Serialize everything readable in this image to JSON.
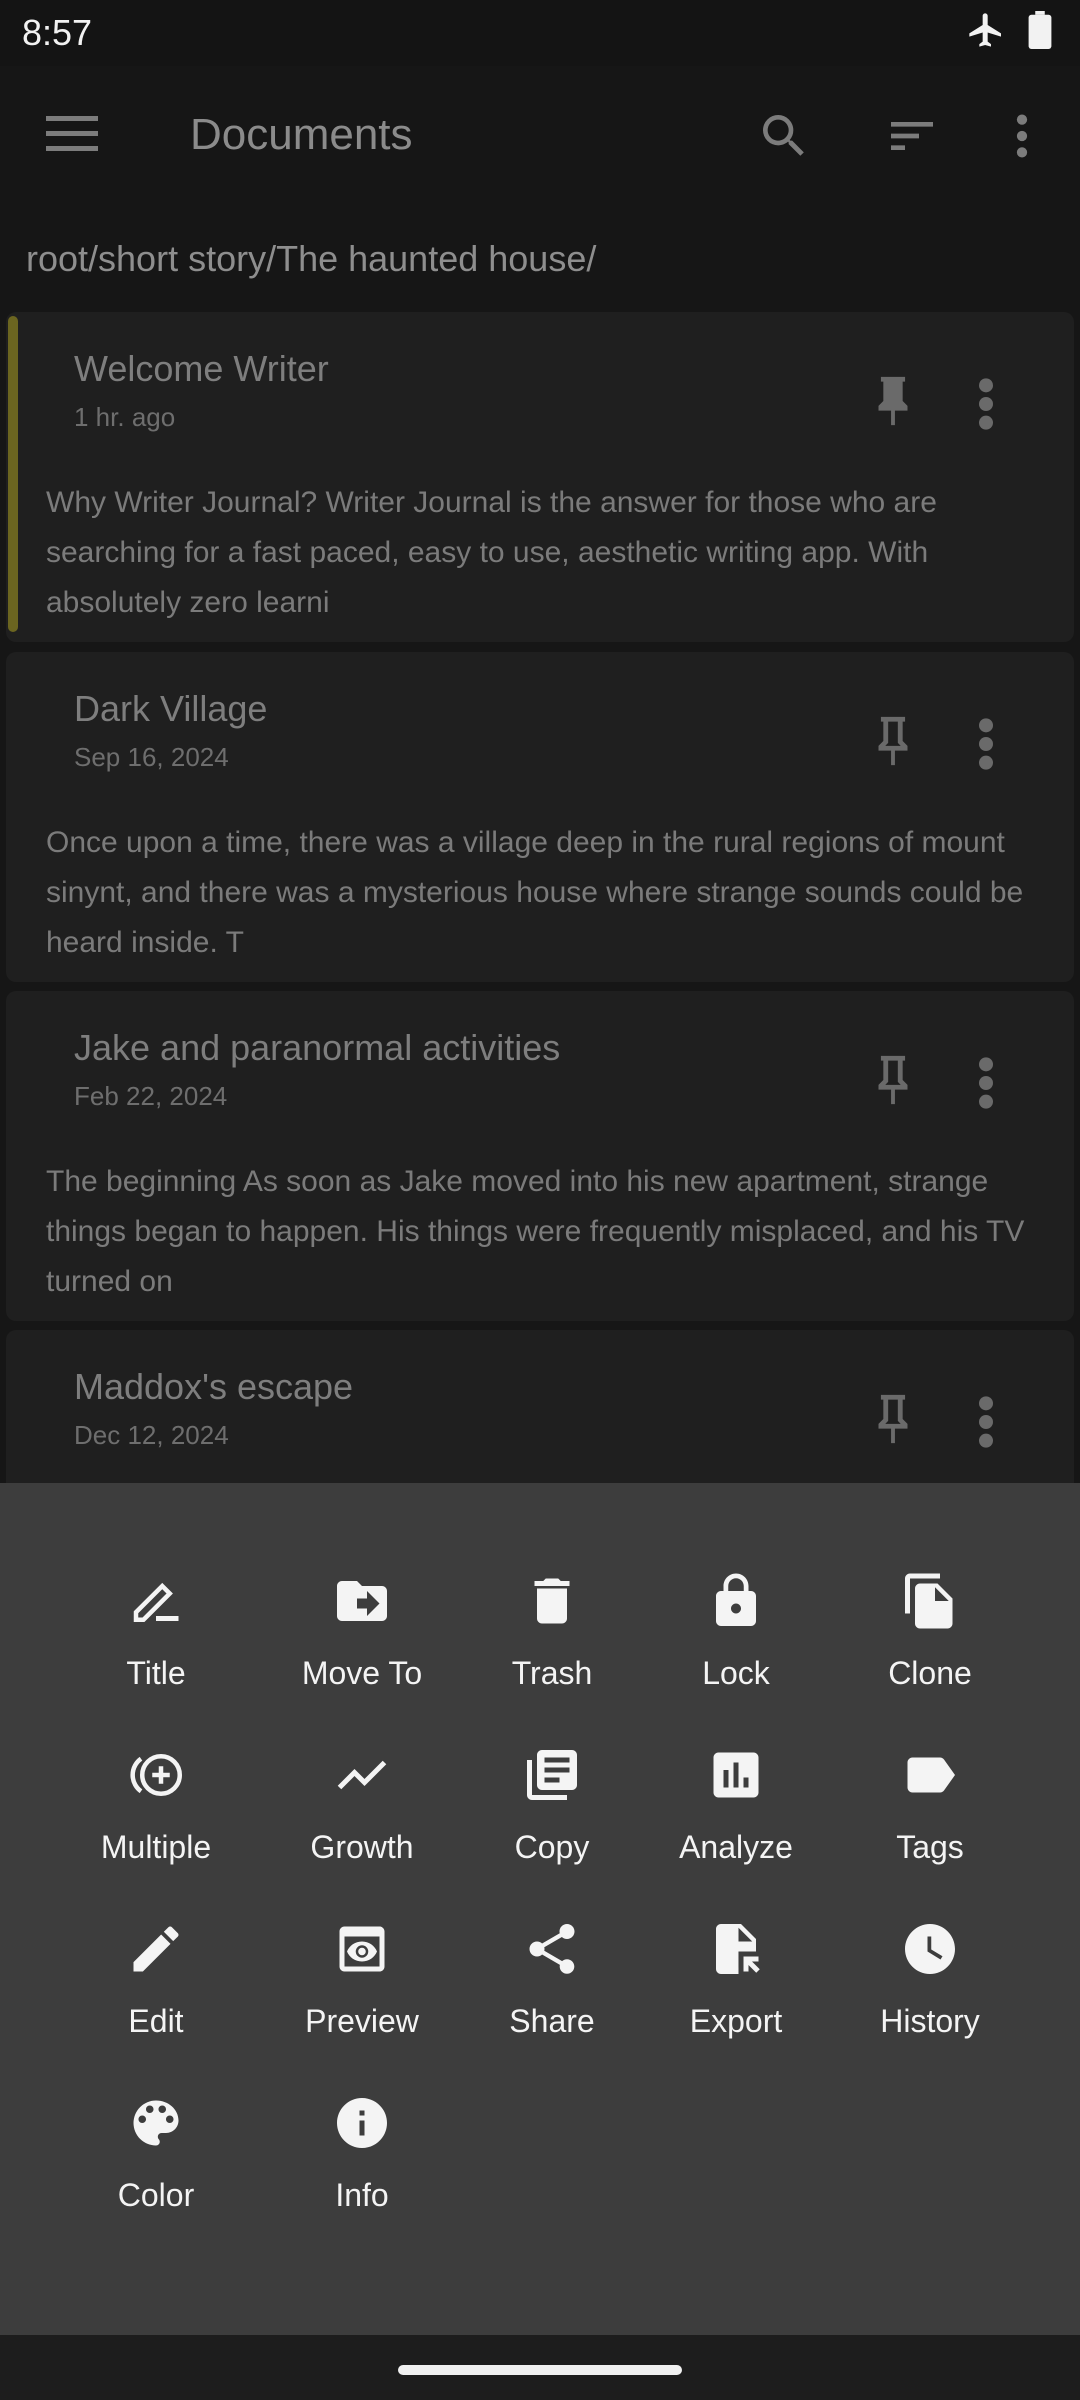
{
  "status": {
    "time": "8:57"
  },
  "appbar": {
    "title": "Documents"
  },
  "path": "root/short story/The haunted house/",
  "documents": [
    {
      "title": "Welcome Writer",
      "date": "1 hr. ago",
      "preview": "Why Writer Journal? Writer Journal is the answer for those who are searching for a fast paced, easy to use, aesthetic writing app. With absolutely zero learni"
    },
    {
      "title": "Dark Village",
      "date": "Sep 16, 2024",
      "preview": "Once upon a time, there was a village deep in the rural regions of mount sinynt, and there was a mysterious house where strange sounds could be heard inside. T"
    },
    {
      "title": "Jake and paranormal activities",
      "date": "Feb 22, 2024",
      "preview": " The beginning As soon as Jake moved into his new apartment, strange things began to happen. His things were frequently misplaced, and his TV turned on"
    },
    {
      "title": "Maddox's escape",
      "date": "Dec 12, 2024",
      "preview": ""
    }
  ],
  "actions": [
    {
      "label": "Title",
      "icon": "title-edit-icon"
    },
    {
      "label": "Move To",
      "icon": "folder-move-icon"
    },
    {
      "label": "Trash",
      "icon": "trash-icon"
    },
    {
      "label": "Lock",
      "icon": "lock-icon"
    },
    {
      "label": "Clone",
      "icon": "clone-icon"
    },
    {
      "label": "Multiple",
      "icon": "multiple-add-icon"
    },
    {
      "label": "Growth",
      "icon": "growth-icon"
    },
    {
      "label": "Copy",
      "icon": "copy-icon"
    },
    {
      "label": "Analyze",
      "icon": "analyze-icon"
    },
    {
      "label": "Tags",
      "icon": "tag-icon"
    },
    {
      "label": "Edit",
      "icon": "pencil-icon"
    },
    {
      "label": "Preview",
      "icon": "preview-icon"
    },
    {
      "label": "Share",
      "icon": "share-icon"
    },
    {
      "label": "Export",
      "icon": "export-icon"
    },
    {
      "label": "History",
      "icon": "history-icon"
    },
    {
      "label": "Color",
      "icon": "palette-icon"
    },
    {
      "label": "Info",
      "icon": "info-icon"
    }
  ],
  "colors": {
    "background": "#161616",
    "card": "#1f1f1f",
    "sheet": "#3d3d3d",
    "pinned_accent": "#6b6520"
  }
}
